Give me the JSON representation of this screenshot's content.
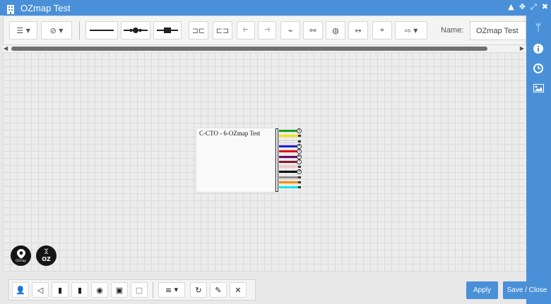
{
  "window": {
    "title": "OZmap Test"
  },
  "toolbar": {
    "name_label": "Name:",
    "name_value": "OZmap Test"
  },
  "node": {
    "title": "C-CTO - 6-OZmap Test",
    "fibers": [
      {
        "color": "#1a9a1a",
        "marker": "circle",
        "text": "1"
      },
      {
        "color": "#f2e600",
        "marker": "square",
        "text": ""
      },
      {
        "color": "#ffffff",
        "marker": "square",
        "text": ""
      },
      {
        "color": "#1c1cd6",
        "marker": "circle",
        "text": "4"
      },
      {
        "color": "#e01010",
        "marker": "circle",
        "text": "5"
      },
      {
        "color": "#6a0a6a",
        "marker": "circle",
        "text": "6"
      },
      {
        "color": "#8a1a2a",
        "marker": "circle",
        "text": "7"
      },
      {
        "color": "#f2c8c8",
        "marker": "square",
        "text": ""
      },
      {
        "color": "#000000",
        "marker": "circle",
        "text": "9"
      },
      {
        "color": "#909090",
        "marker": "square",
        "text": ""
      },
      {
        "color": "#f29000",
        "marker": "square",
        "text": ""
      },
      {
        "color": "#12e6e6",
        "marker": "square",
        "text": ""
      }
    ]
  },
  "logos": {
    "logo1_text": "OZmap",
    "logo2_text": "OZ"
  },
  "buttons": {
    "apply": "Apply",
    "save_close": "Save / Close"
  },
  "colors": {
    "accent": "#4a90d9"
  }
}
